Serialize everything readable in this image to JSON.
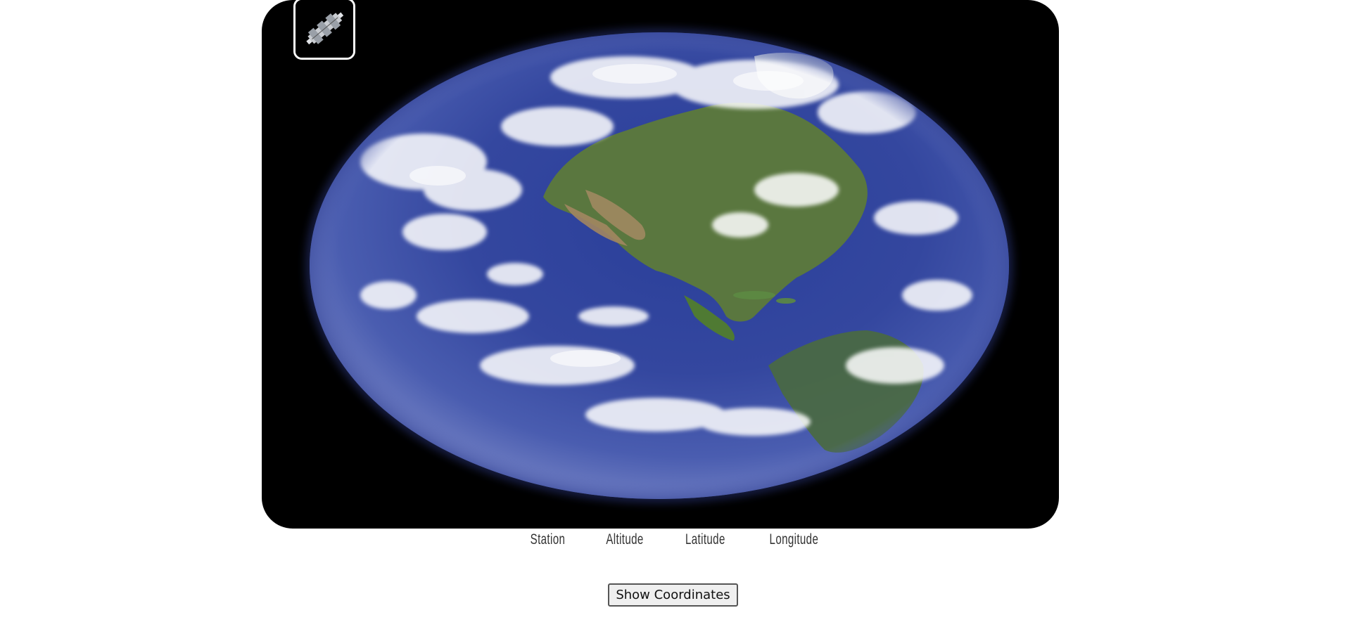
{
  "map": {
    "image_alt": "Earth",
    "station_icon": "iss-station-icon"
  },
  "info": {
    "station_label": "Station",
    "altitude_label": "Altitude",
    "latitude_label": "Latitude",
    "longitude_label": "Longitude"
  },
  "controls": {
    "show_coordinates_label": "Show Coordinates"
  },
  "colors": {
    "frame_background": "#000000",
    "ocean": "#3a4fa6",
    "land": "#5d7a3a",
    "cloud": "#ffffff"
  }
}
